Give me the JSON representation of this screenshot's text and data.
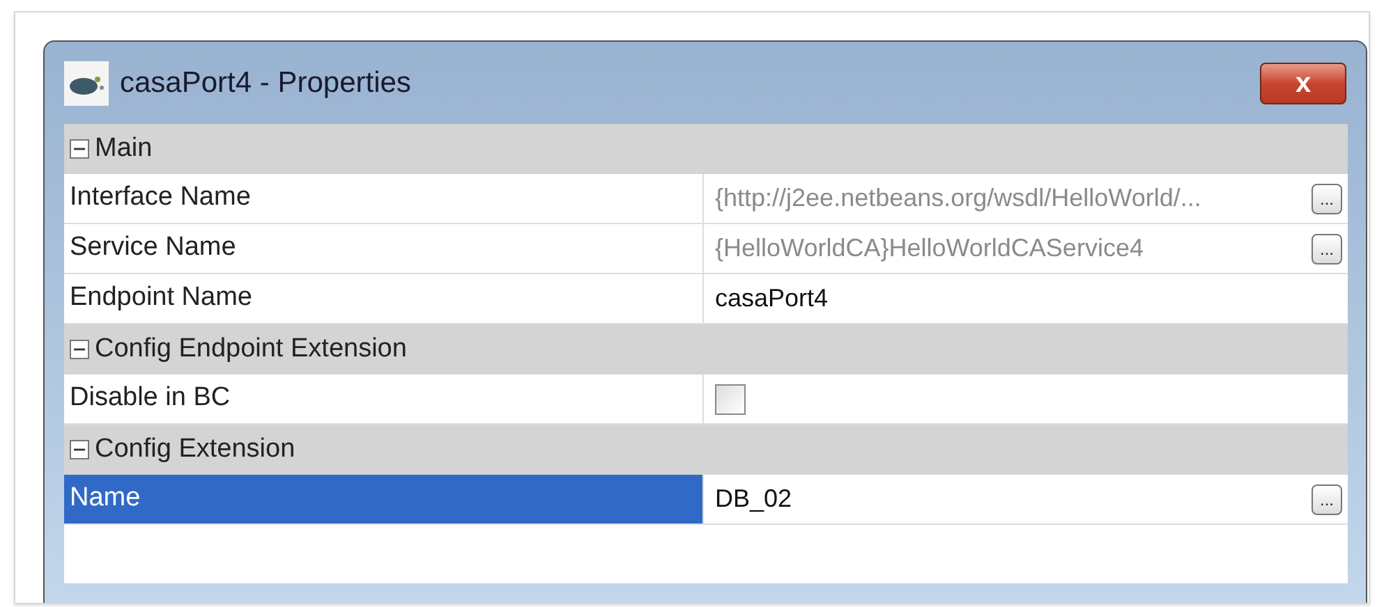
{
  "window": {
    "title": "casaPort4 - Properties",
    "close_label": "x"
  },
  "sections": [
    {
      "title": "Main",
      "expanded": true,
      "properties": [
        {
          "kind": "text",
          "name": "Interface Name",
          "value": "{http://j2ee.netbeans.org/wsdl/HelloWorld/...",
          "readonly": true,
          "button": "...",
          "selected": false
        },
        {
          "kind": "text",
          "name": "Service Name",
          "value": "{HelloWorldCA}HelloWorldCAService4",
          "readonly": true,
          "button": "...",
          "selected": false
        },
        {
          "kind": "text",
          "name": "Endpoint Name",
          "value": "casaPort4",
          "readonly": false,
          "selected": false
        }
      ]
    },
    {
      "title": "Config Endpoint Extension",
      "expanded": true,
      "properties": [
        {
          "kind": "checkbox",
          "name": "Disable in BC",
          "checked": false,
          "selected": false
        }
      ]
    },
    {
      "title": "Config Extension",
      "expanded": true,
      "properties": [
        {
          "kind": "text",
          "name": "Name",
          "value": "DB_02",
          "readonly": false,
          "button": "...",
          "selected": true
        }
      ]
    }
  ]
}
